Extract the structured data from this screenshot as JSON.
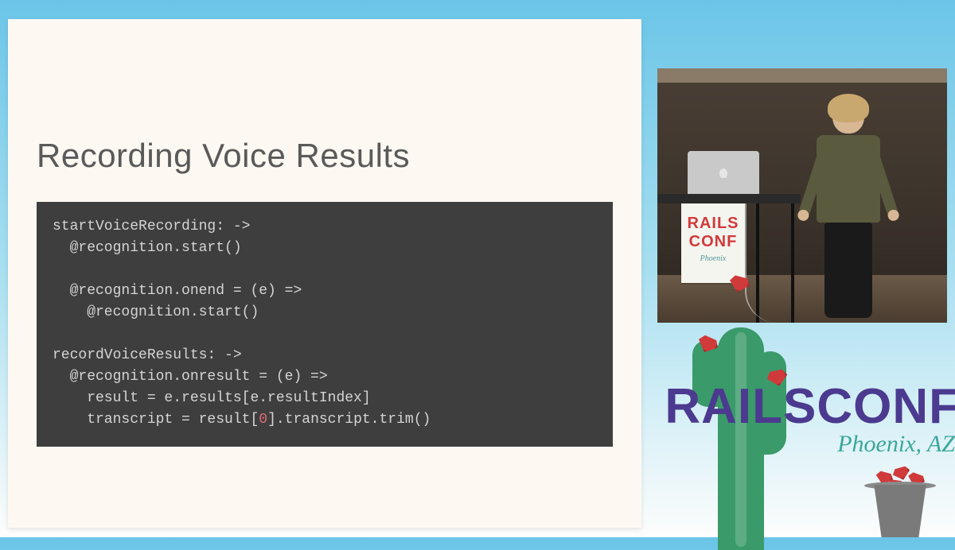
{
  "slide": {
    "title": "Recording Voice Results",
    "code": "startVoiceRecording: ->\n  @recognition.start()\n\n  @recognition.onend = (e) =>\n    @recognition.start()\n\nrecordVoiceResults: ->\n  @recognition.onresult = (e) =>\n    result = e.results[e.resultIndex]\n    transcript = result[0].transcript.trim()",
    "highlight_index": "0"
  },
  "podium_poster": {
    "line1": "RAILS",
    "line2": "CONF",
    "line3": "Phoenix"
  },
  "branding": {
    "title": "RAILSCONF",
    "subtitle": "Phoenix, AZ"
  }
}
